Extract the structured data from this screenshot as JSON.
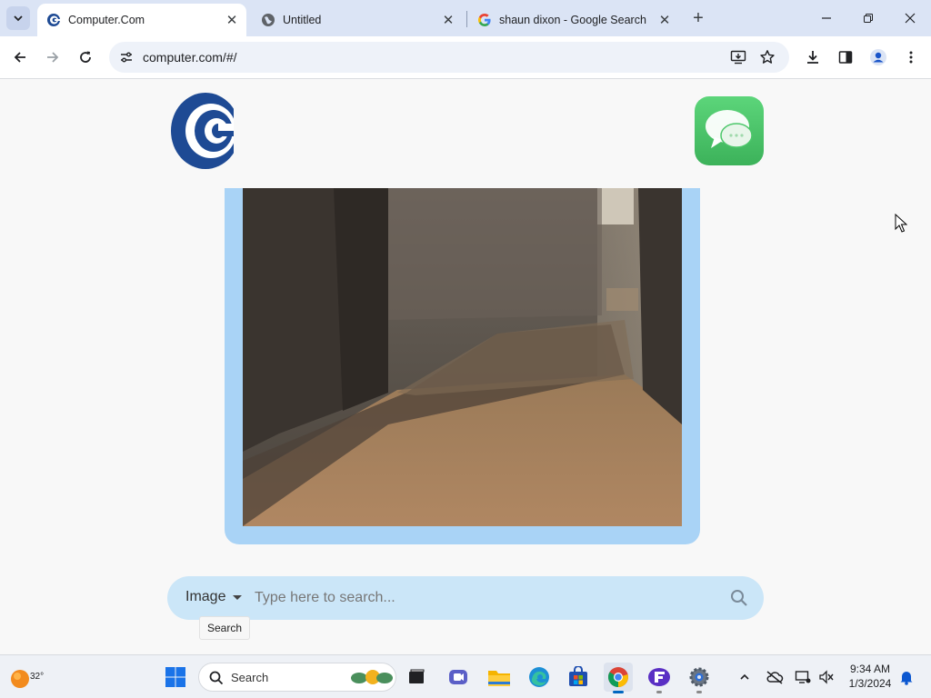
{
  "browser": {
    "tabs": [
      {
        "title": "Computer.Com",
        "favicon": "computer-com-favicon",
        "active": true
      },
      {
        "title": "Untitled",
        "favicon": "globe-icon",
        "active": false
      },
      {
        "title": "shaun dixon - Google Search",
        "favicon": "google-g-icon",
        "active": false
      }
    ],
    "new_tab_glyph": "+",
    "close_glyph": "✕",
    "url": "computer.com/#/"
  },
  "page": {
    "search": {
      "mode": "Image",
      "placeholder": "Type here to search...",
      "value": "",
      "tooltip": "Search"
    }
  },
  "taskbar": {
    "weather_temp": "32°",
    "search_label": "Search",
    "time": "9:34 AM",
    "date": "1/3/2024"
  },
  "colors": {
    "accent": "#0067c0",
    "frame": "#a9d3f6",
    "search_bg": "#cbe6f8",
    "logo_blue": "#1e4a94",
    "messages_green": "#4cc76a"
  }
}
